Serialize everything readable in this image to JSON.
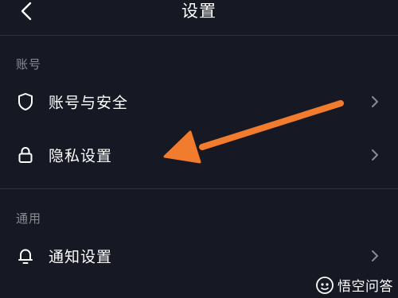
{
  "header": {
    "title": "设置",
    "back_icon": "chevron-left-icon"
  },
  "sections": [
    {
      "header": "账号",
      "items": [
        {
          "label": "账号与安全",
          "icon": "shield-icon"
        },
        {
          "label": "隐私设置",
          "icon": "lock-icon"
        }
      ]
    },
    {
      "header": "通用",
      "items": [
        {
          "label": "通知设置",
          "icon": "bell-icon"
        }
      ]
    }
  ],
  "annotation": {
    "arrow_color": "#f27c2e",
    "points_to": "隐私设置"
  },
  "watermark": {
    "text": "悟空问答"
  },
  "colors": {
    "background": "#161823",
    "section_header": "#8a8b91",
    "text": "#ffffff",
    "chevron": "#8a8b91"
  }
}
